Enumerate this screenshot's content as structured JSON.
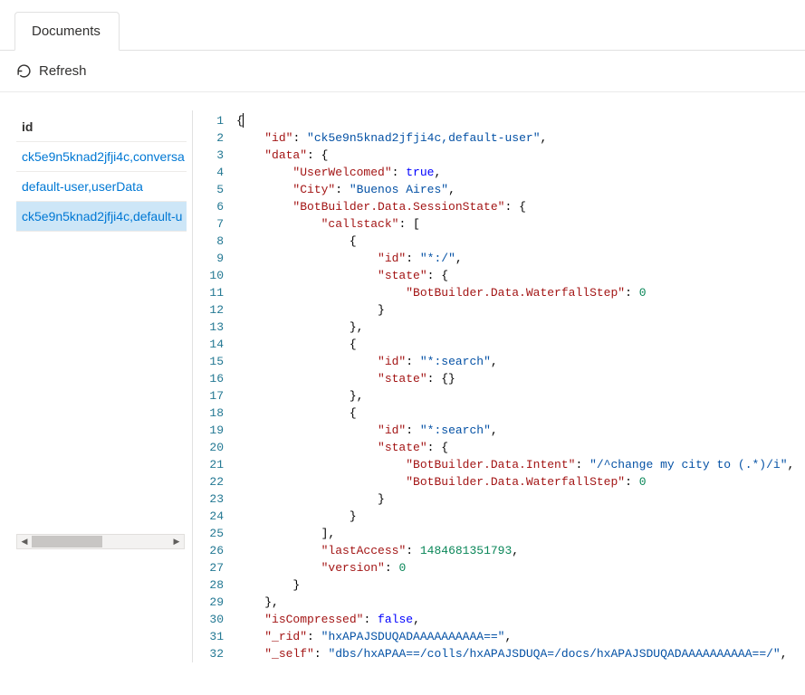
{
  "tab": {
    "label": "Documents"
  },
  "toolbar": {
    "refresh_label": "Refresh"
  },
  "sidebar": {
    "header": "id",
    "items": [
      {
        "label": "ck5e9n5knad2jfji4c,conversa"
      },
      {
        "label": "default-user,userData"
      },
      {
        "label": "ck5e9n5knad2jfji4c,default-u"
      }
    ],
    "selected_index": 2
  },
  "editor": {
    "lines": [
      {
        "n": 1,
        "tokens": [
          {
            "t": "{",
            "c": "punct"
          }
        ]
      },
      {
        "n": 2,
        "tokens": [
          {
            "t": "    ",
            "c": "punct"
          },
          {
            "t": "\"id\"",
            "c": "key"
          },
          {
            "t": ": ",
            "c": "punct"
          },
          {
            "t": "\"ck5e9n5knad2jfji4c,default-user\"",
            "c": "str"
          },
          {
            "t": ",",
            "c": "punct"
          }
        ]
      },
      {
        "n": 3,
        "tokens": [
          {
            "t": "    ",
            "c": "punct"
          },
          {
            "t": "\"data\"",
            "c": "key"
          },
          {
            "t": ": {",
            "c": "punct"
          }
        ]
      },
      {
        "n": 4,
        "tokens": [
          {
            "t": "        ",
            "c": "punct"
          },
          {
            "t": "\"UserWelcomed\"",
            "c": "key"
          },
          {
            "t": ": ",
            "c": "punct"
          },
          {
            "t": "true",
            "c": "bool"
          },
          {
            "t": ",",
            "c": "punct"
          }
        ]
      },
      {
        "n": 5,
        "tokens": [
          {
            "t": "        ",
            "c": "punct"
          },
          {
            "t": "\"City\"",
            "c": "key"
          },
          {
            "t": ": ",
            "c": "punct"
          },
          {
            "t": "\"Buenos Aires\"",
            "c": "str"
          },
          {
            "t": ",",
            "c": "punct"
          }
        ]
      },
      {
        "n": 6,
        "tokens": [
          {
            "t": "        ",
            "c": "punct"
          },
          {
            "t": "\"BotBuilder.Data.SessionState\"",
            "c": "key"
          },
          {
            "t": ": {",
            "c": "punct"
          }
        ]
      },
      {
        "n": 7,
        "tokens": [
          {
            "t": "            ",
            "c": "punct"
          },
          {
            "t": "\"callstack\"",
            "c": "key"
          },
          {
            "t": ": [",
            "c": "punct"
          }
        ]
      },
      {
        "n": 8,
        "tokens": [
          {
            "t": "                {",
            "c": "punct"
          }
        ]
      },
      {
        "n": 9,
        "tokens": [
          {
            "t": "                    ",
            "c": "punct"
          },
          {
            "t": "\"id\"",
            "c": "key"
          },
          {
            "t": ": ",
            "c": "punct"
          },
          {
            "t": "\"*:/\"",
            "c": "str"
          },
          {
            "t": ",",
            "c": "punct"
          }
        ]
      },
      {
        "n": 10,
        "tokens": [
          {
            "t": "                    ",
            "c": "punct"
          },
          {
            "t": "\"state\"",
            "c": "key"
          },
          {
            "t": ": {",
            "c": "punct"
          }
        ]
      },
      {
        "n": 11,
        "tokens": [
          {
            "t": "                        ",
            "c": "punct"
          },
          {
            "t": "\"BotBuilder.Data.WaterfallStep\"",
            "c": "key"
          },
          {
            "t": ": ",
            "c": "punct"
          },
          {
            "t": "0",
            "c": "num"
          }
        ]
      },
      {
        "n": 12,
        "tokens": [
          {
            "t": "                    }",
            "c": "punct"
          }
        ]
      },
      {
        "n": 13,
        "tokens": [
          {
            "t": "                },",
            "c": "punct"
          }
        ]
      },
      {
        "n": 14,
        "tokens": [
          {
            "t": "                {",
            "c": "punct"
          }
        ]
      },
      {
        "n": 15,
        "tokens": [
          {
            "t": "                    ",
            "c": "punct"
          },
          {
            "t": "\"id\"",
            "c": "key"
          },
          {
            "t": ": ",
            "c": "punct"
          },
          {
            "t": "\"*:search\"",
            "c": "str"
          },
          {
            "t": ",",
            "c": "punct"
          }
        ]
      },
      {
        "n": 16,
        "tokens": [
          {
            "t": "                    ",
            "c": "punct"
          },
          {
            "t": "\"state\"",
            "c": "key"
          },
          {
            "t": ": {}",
            "c": "punct"
          }
        ]
      },
      {
        "n": 17,
        "tokens": [
          {
            "t": "                },",
            "c": "punct"
          }
        ]
      },
      {
        "n": 18,
        "tokens": [
          {
            "t": "                {",
            "c": "punct"
          }
        ]
      },
      {
        "n": 19,
        "tokens": [
          {
            "t": "                    ",
            "c": "punct"
          },
          {
            "t": "\"id\"",
            "c": "key"
          },
          {
            "t": ": ",
            "c": "punct"
          },
          {
            "t": "\"*:search\"",
            "c": "str"
          },
          {
            "t": ",",
            "c": "punct"
          }
        ]
      },
      {
        "n": 20,
        "tokens": [
          {
            "t": "                    ",
            "c": "punct"
          },
          {
            "t": "\"state\"",
            "c": "key"
          },
          {
            "t": ": {",
            "c": "punct"
          }
        ]
      },
      {
        "n": 21,
        "tokens": [
          {
            "t": "                        ",
            "c": "punct"
          },
          {
            "t": "\"BotBuilder.Data.Intent\"",
            "c": "key"
          },
          {
            "t": ": ",
            "c": "punct"
          },
          {
            "t": "\"/^change my city to (.*)/i\"",
            "c": "str"
          },
          {
            "t": ",",
            "c": "punct"
          }
        ]
      },
      {
        "n": 22,
        "tokens": [
          {
            "t": "                        ",
            "c": "punct"
          },
          {
            "t": "\"BotBuilder.Data.WaterfallStep\"",
            "c": "key"
          },
          {
            "t": ": ",
            "c": "punct"
          },
          {
            "t": "0",
            "c": "num"
          }
        ]
      },
      {
        "n": 23,
        "tokens": [
          {
            "t": "                    }",
            "c": "punct"
          }
        ]
      },
      {
        "n": 24,
        "tokens": [
          {
            "t": "                }",
            "c": "punct"
          }
        ]
      },
      {
        "n": 25,
        "tokens": [
          {
            "t": "            ],",
            "c": "punct"
          }
        ]
      },
      {
        "n": 26,
        "tokens": [
          {
            "t": "            ",
            "c": "punct"
          },
          {
            "t": "\"lastAccess\"",
            "c": "key"
          },
          {
            "t": ": ",
            "c": "punct"
          },
          {
            "t": "1484681351793",
            "c": "num"
          },
          {
            "t": ",",
            "c": "punct"
          }
        ]
      },
      {
        "n": 27,
        "tokens": [
          {
            "t": "            ",
            "c": "punct"
          },
          {
            "t": "\"version\"",
            "c": "key"
          },
          {
            "t": ": ",
            "c": "punct"
          },
          {
            "t": "0",
            "c": "num"
          }
        ]
      },
      {
        "n": 28,
        "tokens": [
          {
            "t": "        }",
            "c": "punct"
          }
        ]
      },
      {
        "n": 29,
        "tokens": [
          {
            "t": "    },",
            "c": "punct"
          }
        ]
      },
      {
        "n": 30,
        "tokens": [
          {
            "t": "    ",
            "c": "punct"
          },
          {
            "t": "\"isCompressed\"",
            "c": "key"
          },
          {
            "t": ": ",
            "c": "punct"
          },
          {
            "t": "false",
            "c": "bool"
          },
          {
            "t": ",",
            "c": "punct"
          }
        ]
      },
      {
        "n": 31,
        "tokens": [
          {
            "t": "    ",
            "c": "punct"
          },
          {
            "t": "\"_rid\"",
            "c": "key"
          },
          {
            "t": ": ",
            "c": "punct"
          },
          {
            "t": "\"hxAPAJSDUQADAAAAAAAAAA==\"",
            "c": "str"
          },
          {
            "t": ",",
            "c": "punct"
          }
        ]
      },
      {
        "n": 32,
        "tokens": [
          {
            "t": "    ",
            "c": "punct"
          },
          {
            "t": "\"_self\"",
            "c": "key"
          },
          {
            "t": ": ",
            "c": "punct"
          },
          {
            "t": "\"dbs/hxAPAA==/colls/hxAPAJSDUQA=/docs/hxAPAJSDUQADAAAAAAAAAA==/\"",
            "c": "str"
          },
          {
            "t": ",",
            "c": "punct"
          }
        ]
      }
    ]
  }
}
